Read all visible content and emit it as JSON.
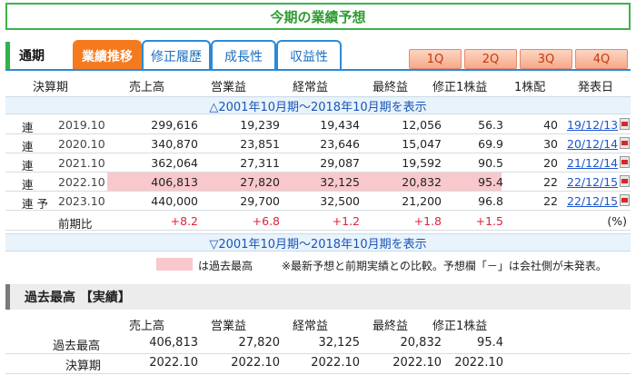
{
  "title": "今期の業績予想",
  "tabs": {
    "tsuki": "通期",
    "items": [
      "業績推移",
      "修正履歴",
      "成長性",
      "収益性"
    ],
    "quarters": [
      "1Q",
      "2Q",
      "3Q",
      "4Q"
    ]
  },
  "headers": [
    "決算期",
    "売上高",
    "営業益",
    "経常益",
    "最終益",
    "修正1株益",
    "1株配",
    "発表日"
  ],
  "band_top": "△2001年10月期～2018年10月期を表示",
  "band_bottom": "▽2001年10月期～2018年10月期を表示",
  "rows": [
    {
      "type": "連",
      "period": "2019.10",
      "sales": "299,616",
      "op": "19,239",
      "ord": "19,434",
      "net": "12,056",
      "eps": "56.3",
      "div": "40",
      "date": "19/12/13",
      "hl": false
    },
    {
      "type": "連",
      "period": "2020.10",
      "sales": "340,870",
      "op": "23,851",
      "ord": "23,646",
      "net": "15,047",
      "eps": "69.9",
      "div": "30",
      "date": "20/12/14",
      "hl": false
    },
    {
      "type": "連",
      "period": "2021.10",
      "sales": "362,064",
      "op": "27,311",
      "ord": "29,087",
      "net": "19,592",
      "eps": "90.5",
      "div": "20",
      "date": "21/12/14",
      "hl": false
    },
    {
      "type": "連",
      "period": "2022.10",
      "sales": "406,813",
      "op": "27,820",
      "ord": "32,125",
      "net": "20,832",
      "eps": "95.4",
      "div": "22",
      "date": "22/12/15",
      "hl": true
    },
    {
      "type": "連 予",
      "period": "2023.10",
      "sales": "440,000",
      "op": "29,700",
      "ord": "32,500",
      "net": "21,200",
      "eps": "96.8",
      "div": "22",
      "date": "22/12/15",
      "hl": false
    }
  ],
  "yoy": {
    "label": "前期比",
    "sales": "+8.2",
    "op": "+6.8",
    "ord": "+1.2",
    "net": "+1.8",
    "eps": "+1.5",
    "unit": "(%)"
  },
  "legend": "は過去最高",
  "note": "※最新予想と前期実績との比較。予想欄「－」は会社側が未発表。",
  "record": {
    "title": "過去最高 【実績】",
    "headers": [
      "売上高",
      "営業益",
      "経常益",
      "最終益",
      "修正1株益"
    ],
    "row1_label": "過去最高",
    "row1": [
      "406,813",
      "27,820",
      "32,125",
      "20,832",
      "95.4"
    ],
    "row2_label": "決算期",
    "row2": [
      "2022.10",
      "2022.10",
      "2022.10",
      "2022.10",
      "2022.10"
    ]
  },
  "colors": {
    "accent_green": "#39b54a",
    "tab_blue": "#2a8ad8",
    "active_orange": "#f57a1e",
    "highlight": "#f8c8cc",
    "positive": "#e0223a"
  }
}
